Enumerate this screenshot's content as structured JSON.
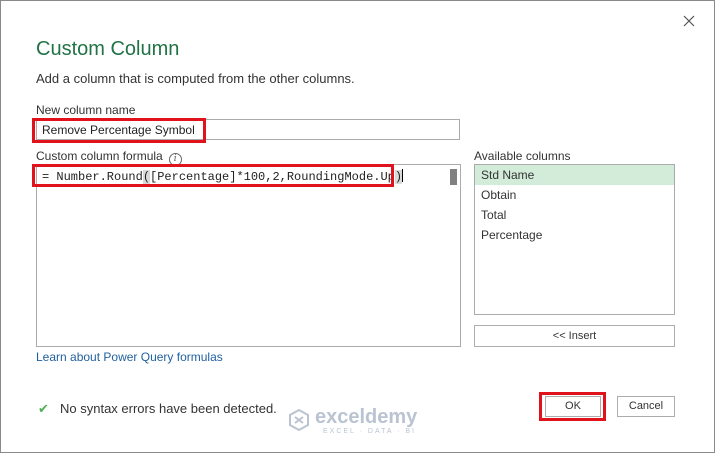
{
  "dialog": {
    "title": "Custom Column",
    "subtitle": "Add a column that is computed from the other columns.",
    "close_icon": "close-icon"
  },
  "new_column": {
    "label": "New column name",
    "value": "Remove Percentage Symbol"
  },
  "formula": {
    "label": "Custom column formula",
    "info_icon": "info-icon",
    "prefix": "= Number.Round",
    "open_paren": "(",
    "body": "[Percentage]*100,2,RoundingMode.Up",
    "close_paren": ")"
  },
  "available": {
    "label": "Available columns",
    "items": [
      "Std Name",
      "Obtain",
      "Total",
      "Percentage"
    ],
    "selected": "Std Name",
    "insert_label": "<< Insert"
  },
  "learn_link": "Learn about Power Query formulas",
  "status": {
    "icon": "checkmark-icon",
    "text": "No syntax errors have been detected."
  },
  "buttons": {
    "ok": "OK",
    "cancel": "Cancel"
  },
  "watermark": {
    "main": "exceldemy",
    "sub": "EXCEL · DATA · BI"
  },
  "colors": {
    "title": "#217346",
    "highlight": "#e0121b",
    "selected_row": "#d3ecd9",
    "link": "#1f5f9f"
  }
}
